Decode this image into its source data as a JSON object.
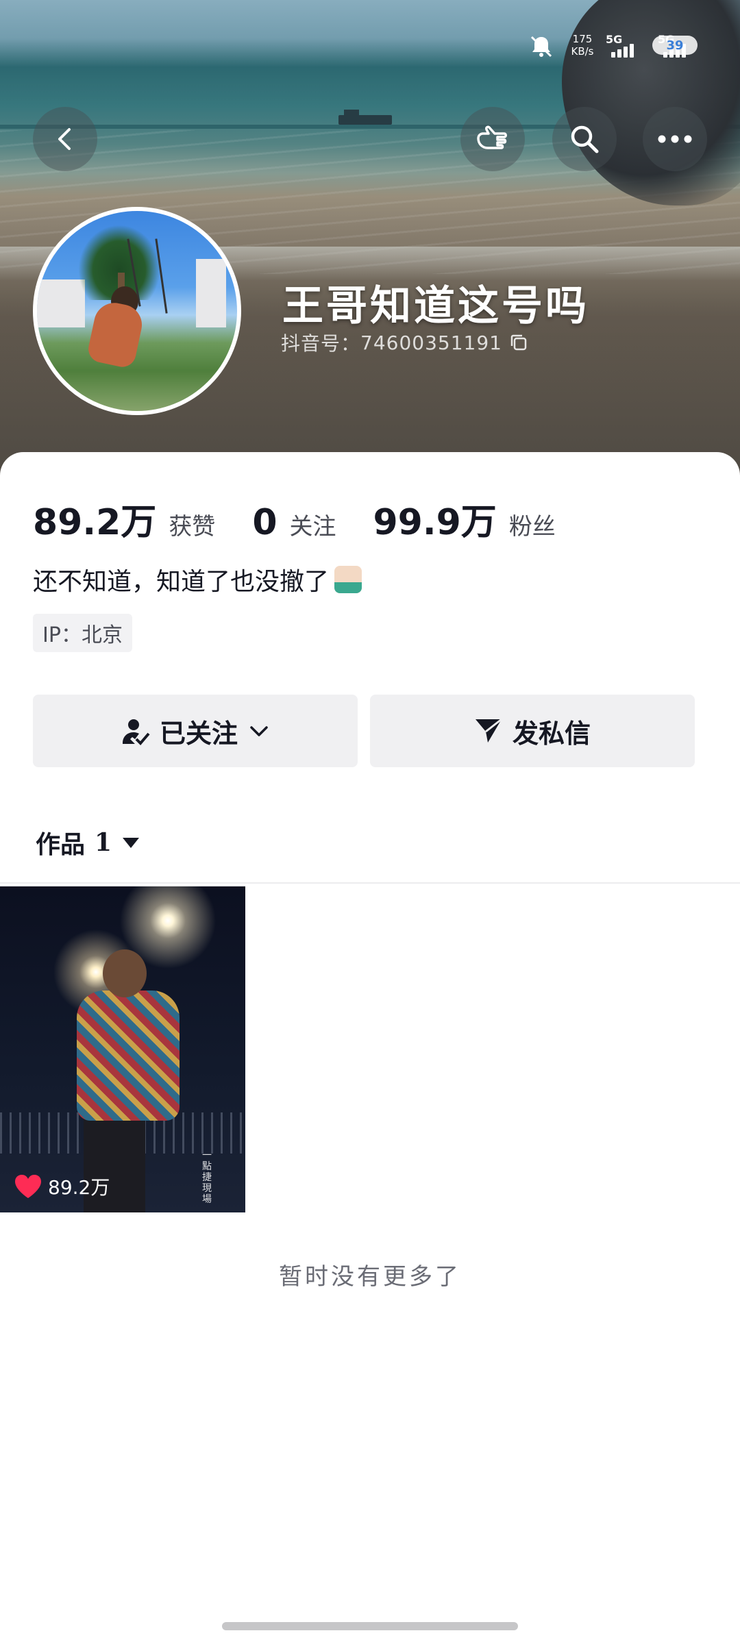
{
  "status_bar": {
    "net_speed": "175",
    "net_unit": "KB/s",
    "sim1": "5G",
    "sim2": "5G",
    "battery": "39"
  },
  "header": {
    "back_icon": "chevron-left-icon",
    "actions": [
      "pointing-hand-icon",
      "search-icon",
      "more-icon"
    ]
  },
  "profile": {
    "username": "王哥知道这号吗",
    "douyin_id_label": "抖音号：",
    "douyin_id": "74600351191",
    "stats": [
      {
        "value": "89.2万",
        "label": "获赞"
      },
      {
        "value": "0",
        "label": "关注"
      },
      {
        "value": "99.9万",
        "label": "粉丝"
      }
    ],
    "bio": "还不知道，知道了也没撤了",
    "ip": "IP：北京"
  },
  "buttons": {
    "follow": "已关注",
    "message": "发私信"
  },
  "works": {
    "tab_label": "作品",
    "count": "1",
    "items": [
      {
        "likes": "89.2万",
        "watermark": "一點捷現場"
      }
    ],
    "end_text": "暂时没有更多了"
  },
  "colors": {
    "like_red": "#fe2c55",
    "text_primary": "#161823",
    "button_bg": "#f0f0f2"
  }
}
